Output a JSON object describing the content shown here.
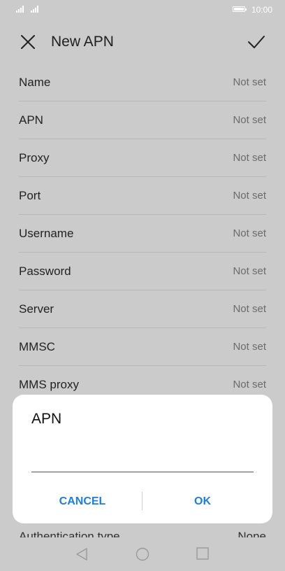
{
  "status_bar": {
    "time": "10:00",
    "battery_level": 0.9
  },
  "header": {
    "title": "New APN"
  },
  "settings": [
    {
      "label": "Name",
      "value": "Not set"
    },
    {
      "label": "APN",
      "value": "Not set"
    },
    {
      "label": "Proxy",
      "value": "Not set"
    },
    {
      "label": "Port",
      "value": "Not set"
    },
    {
      "label": "Username",
      "value": "Not set"
    },
    {
      "label": "Password",
      "value": "Not set"
    },
    {
      "label": "Server",
      "value": "Not set"
    },
    {
      "label": "MMSC",
      "value": "Not set"
    },
    {
      "label": "MMS proxy",
      "value": "Not set"
    }
  ],
  "peek_row": {
    "label": "Authentication type",
    "value": "None"
  },
  "dialog": {
    "title": "APN",
    "input_value": "",
    "cancel_label": "CANCEL",
    "ok_label": "OK"
  },
  "colors": {
    "accent": "#1a7fe0",
    "background": "#cbcbcb",
    "dialog_bg": "#ffffff"
  }
}
